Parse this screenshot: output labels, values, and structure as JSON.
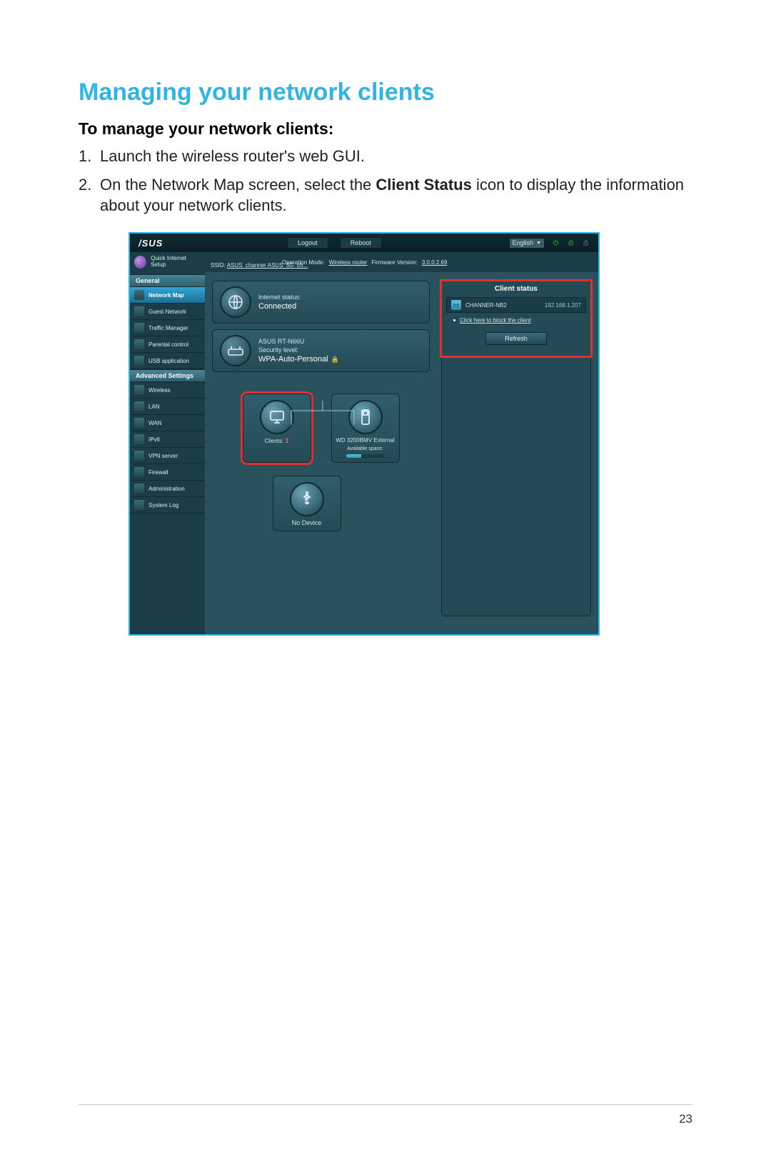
{
  "doc": {
    "title": "Managing your network clients",
    "subtitle": "To manage your network clients:",
    "step1": "Launch the wireless router's web GUI.",
    "step2_a": "On the Network Map screen, select the ",
    "step2_bold": "Client Status",
    "step2_b": " icon to display the information about your network clients.",
    "page_number": "23"
  },
  "top": {
    "brand": "/SUS",
    "logout": "Logout",
    "reboot": "Reboot",
    "lang": "English"
  },
  "mode_row": {
    "op_label": "Operation Mode:",
    "op_value": "Wireless router",
    "fw_label": "Firmware Version:",
    "fw_value": "3.0.0.2.69",
    "ssid_label": "SSID:",
    "ssid_value": "ASUS_channer  ASUS_5G_ch..."
  },
  "sidebar": {
    "quick": "Quick Internet Setup",
    "general": "General",
    "adv": "Advanced Settings",
    "general_items": [
      "Network Map",
      "Guest Network",
      "Traffic Manager",
      "Parental control",
      "USB application"
    ],
    "adv_items": [
      "Wireless",
      "LAN",
      "WAN",
      "IPv6",
      "VPN server",
      "Firewall",
      "Administration",
      "System Log"
    ]
  },
  "tiles": {
    "internet_label": "Internet status:",
    "internet_value": "Connected",
    "router_model": "ASUS RT-N66U",
    "sec_label": "Security level:",
    "sec_value": "WPA-Auto-Personal",
    "clients_label": "Clients:",
    "clients_count": "1",
    "storage_label": "WD 3200BMV External",
    "storage_sub": "Available space:",
    "usb_label": "No Device"
  },
  "client": {
    "title": "Client status",
    "row_name": "CHANNER-NB2",
    "row_ip": "192.168.1.207",
    "block_link": "Click here to block the client",
    "refresh": "Refresh"
  }
}
